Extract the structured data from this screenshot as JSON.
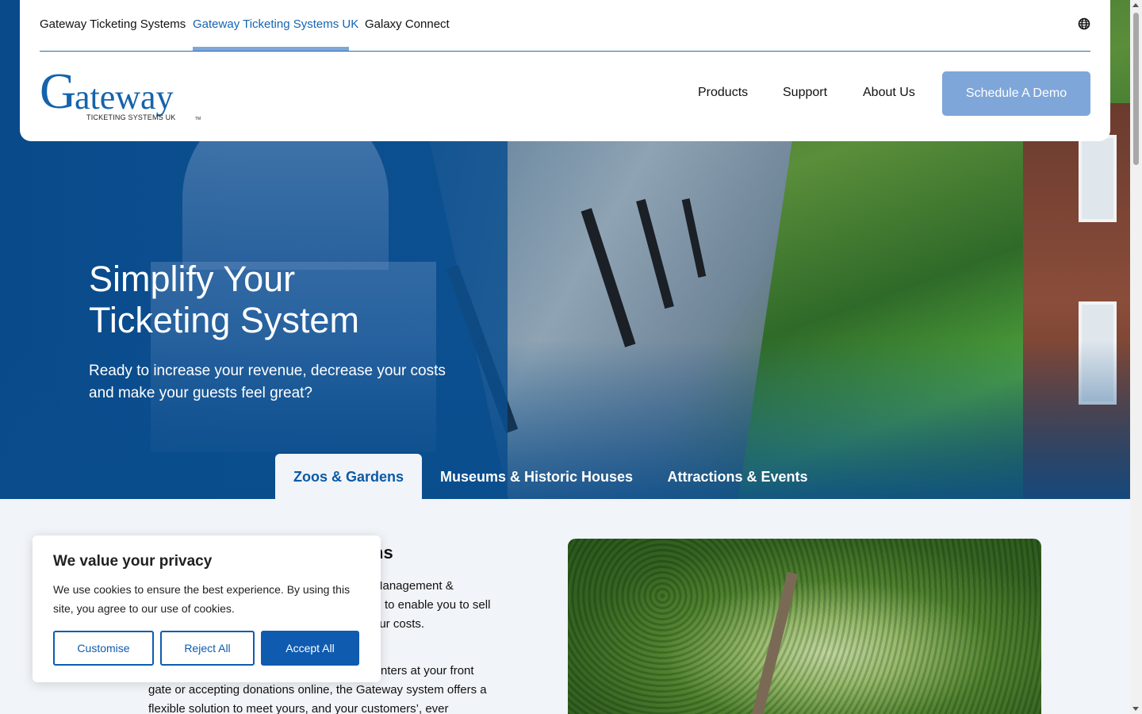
{
  "topnav": {
    "links": [
      "Gateway Ticketing Systems",
      "Gateway Ticketing Systems UK",
      "Galaxy Connect"
    ],
    "active_index": 1,
    "globe_icon": "globe-icon"
  },
  "logo": {
    "text_main": "ateway",
    "text_initial": "G",
    "subtitle": "TICKETING SYSTEMS UK",
    "tm": "TM"
  },
  "mainnav": {
    "products": "Products",
    "support": "Support",
    "about": "About Us",
    "demo": "Schedule A Demo"
  },
  "hero": {
    "title": "Simplify Your Ticketing System",
    "subtitle": "Ready to increase your revenue, decrease your costs and make your guests feel great?"
  },
  "tabs": [
    "Zoos & Gardens",
    "Museums & Historic Houses",
    "Attractions & Events"
  ],
  "content": {
    "heading_tail": "ns",
    "p1_line1": "Management &",
    "p1_line2": "to enable you to sell",
    "p1_line3": "our costs.",
    "p2_line1": "nters at your front",
    "p2_line2": "gate or accepting donations online, the Gateway system offers a",
    "p2_line3": "flexible solution to meet yours, and your customers’, ever"
  },
  "cookie": {
    "title": "We value your privacy",
    "text": "We use cookies to ensure the best experience. By using this site, you agree to our use of cookies.",
    "customise": "Customise",
    "reject": "Reject All",
    "accept": "Accept All"
  },
  "colors": {
    "brand_blue": "#1563ab",
    "accent_light_blue": "#7ea6d9",
    "button_blue": "#0f5bb0"
  }
}
